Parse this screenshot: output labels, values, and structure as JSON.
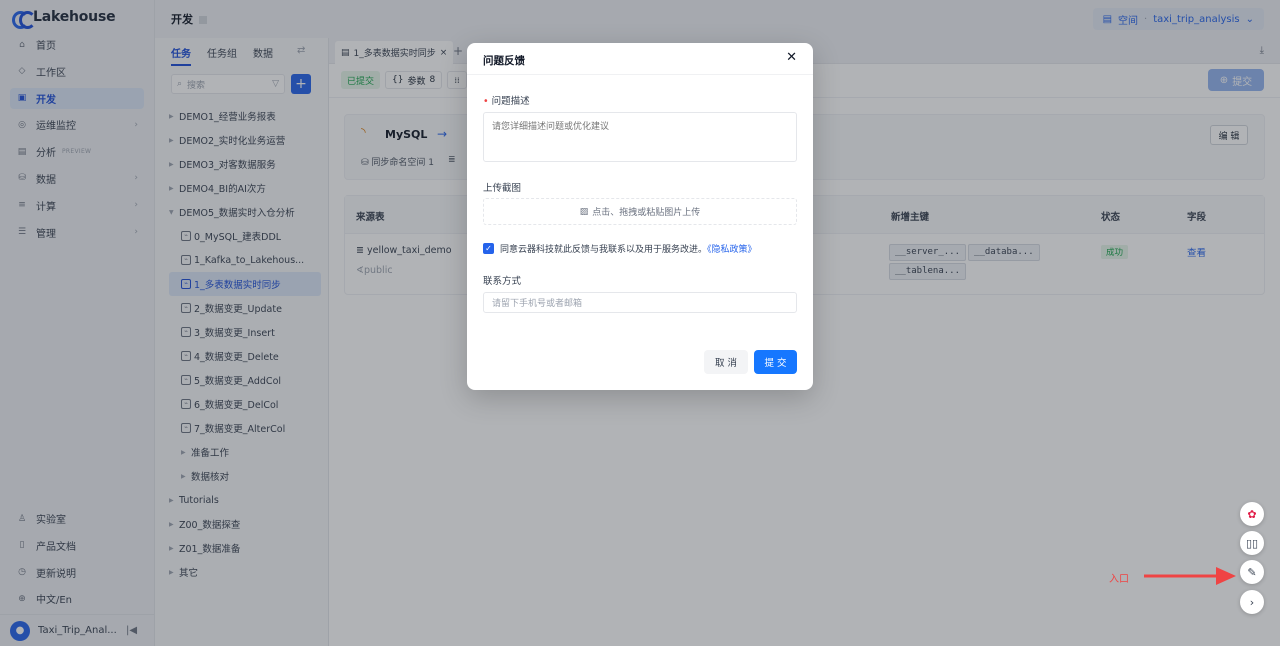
{
  "app": {
    "logo_text": "Lakehouse"
  },
  "nav": {
    "items": [
      {
        "label": "首页",
        "icon": "home-icon",
        "glyph": "⌂",
        "caret": false
      },
      {
        "label": "工作区",
        "icon": "cube-icon",
        "glyph": "◇",
        "caret": false
      },
      {
        "label": "开发",
        "icon": "code-icon",
        "glyph": "▣",
        "caret": false,
        "active": true
      },
      {
        "label": "运维监控",
        "icon": "monitor-icon",
        "glyph": "◎",
        "caret": true
      },
      {
        "label": "分析",
        "icon": "chart-icon",
        "glyph": "▤",
        "caret": false,
        "badge": "PREVIEW"
      },
      {
        "label": "数据",
        "icon": "database-icon",
        "glyph": "⛁",
        "caret": true
      },
      {
        "label": "计算",
        "icon": "compute-icon",
        "glyph": "≡",
        "caret": true
      },
      {
        "label": "管理",
        "icon": "manage-icon",
        "glyph": "☰",
        "caret": true
      }
    ],
    "bottom": [
      {
        "label": "实验室",
        "icon": "lab-icon",
        "glyph": "♙"
      },
      {
        "label": "产品文档",
        "icon": "book-icon",
        "glyph": "▯"
      },
      {
        "label": "更新说明",
        "icon": "update-icon",
        "glyph": "◷"
      },
      {
        "label": "中文/En",
        "icon": "globe-icon",
        "glyph": "⊕"
      }
    ],
    "user": "Taxi_Trip_Anal..."
  },
  "header": {
    "title": "开发",
    "workspace_label": "空间",
    "workspace_name": "taxi_trip_analysis"
  },
  "tree": {
    "tabs": [
      "任务",
      "任务组",
      "数据"
    ],
    "search_placeholder": "搜索",
    "rows": [
      {
        "label": "DEMO1_经营业务报表",
        "type": "folder"
      },
      {
        "label": "DEMO2_实时化业务运营",
        "type": "folder"
      },
      {
        "label": "DEMO3_对客数据服务",
        "type": "folder"
      },
      {
        "label": "DEMO4_BI的AI次方",
        "type": "folder"
      },
      {
        "label": "DEMO5_数据实时入仓分析",
        "type": "open"
      },
      {
        "label": "0_MySQL_建表DDL",
        "type": "file"
      },
      {
        "label": "1_Kafka_to_Lakehous...",
        "type": "file"
      },
      {
        "label": "1_多表数据实时同步",
        "type": "file",
        "active": true
      },
      {
        "label": "2_数据变更_Update",
        "type": "file"
      },
      {
        "label": "3_数据变更_Insert",
        "type": "file"
      },
      {
        "label": "4_数据变更_Delete",
        "type": "file"
      },
      {
        "label": "5_数据变更_AddCol",
        "type": "file"
      },
      {
        "label": "6_数据变更_DelCol",
        "type": "file"
      },
      {
        "label": "7_数据变更_AlterCol",
        "type": "file"
      },
      {
        "label": "准备工作",
        "type": "subfolder"
      },
      {
        "label": "数据核对",
        "type": "subfolder"
      },
      {
        "label": "Tutorials",
        "type": "folder"
      },
      {
        "label": "Z00_数据探查",
        "type": "folder"
      },
      {
        "label": "Z01_数据准备",
        "type": "folder"
      },
      {
        "label": "其它",
        "type": "folder"
      }
    ]
  },
  "editor": {
    "tab_label": "1_多表数据实时同步",
    "status": "已提交",
    "param_label": "参数",
    "param_count": "8",
    "submit_label": "提交",
    "source_name": "MySQL",
    "meta1": "同步命名空间 1",
    "edit_label": "编 辑",
    "table": {
      "headers": [
        "来源表",
        "新增主键",
        "状态",
        "字段"
      ],
      "row": {
        "source": "yellow_taxi_demo",
        "schema": "public",
        "keys": [
          "__server_...",
          "__databa...",
          "__tablena..."
        ],
        "status": "成功",
        "field_link": "查看"
      }
    }
  },
  "modal": {
    "title": "问题反馈",
    "desc_label": "问题描述",
    "desc_placeholder": "请您详细描述问题或优化建议",
    "upload_label": "上传截图",
    "upload_hint": "点击、拖拽或粘贴图片上传",
    "agree_text": "同意云器科技就此反馈与我联系以及用于服务改进。",
    "privacy_link": "《隐私政策》",
    "contact_label": "联系方式",
    "contact_placeholder": "请留下手机号或者邮箱",
    "cancel_label": "取 消",
    "submit_label": "提 交"
  },
  "annotation": {
    "text": "入口",
    "color": "#ef4444"
  }
}
